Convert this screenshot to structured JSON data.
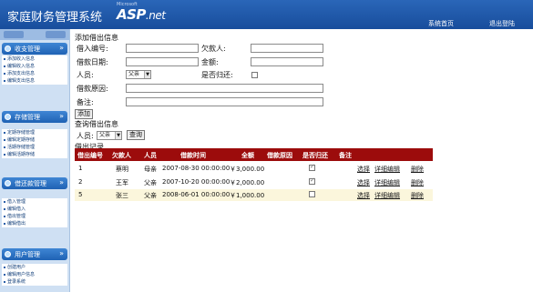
{
  "header": {
    "title": "家庭财务管理系统",
    "logo_small": "Microsoft",
    "logo_main": "ASP",
    "logo_net": ".net",
    "home_link": "系统首页",
    "logout_link": "退出登陆"
  },
  "sidebar": {
    "sections": [
      {
        "title": "收支管理",
        "items": [
          "添加收入信息",
          "编辑收入信息",
          "添加支出信息",
          "编辑支出信息"
        ]
      },
      {
        "title": "存储管理",
        "items": [
          "定期存储管理",
          "编辑定期存储",
          "活期存储管理",
          "编辑活期存储"
        ]
      },
      {
        "title": "借还款管理",
        "items": [
          "借入管理",
          "编辑借入",
          "借出管理",
          "编辑借出"
        ]
      },
      {
        "title": "用户管理",
        "items": [
          "创建用户",
          "编辑用户信息",
          "登录系统"
        ]
      }
    ]
  },
  "form": {
    "section_title": "添加借出信息",
    "borrow_no_label": "借入编号:",
    "debtor_label": "欠款人:",
    "date_label": "借款日期:",
    "amount_label": "金额:",
    "person_label": "人员:",
    "person_value": "父亲",
    "returned_label": "是否归还:",
    "reason_label": "借款原因:",
    "note_label": "备注:",
    "add_button": "添加"
  },
  "query": {
    "section_title": "查询借出信息",
    "person_label": "人员:",
    "person_value": "父亲",
    "query_button": "查询",
    "records_title": "借出记录"
  },
  "table": {
    "headers": [
      "借出编号",
      "欠款人",
      "人员",
      "借款时间",
      "全额",
      "借款原因",
      "是否归还",
      "备注"
    ],
    "rows": [
      {
        "id": "1",
        "debtor": "蔡明",
        "person": "母亲",
        "time": "2007-08-30 00:00:00",
        "amount": "￥3,000.00",
        "returned": true,
        "actions": [
          "选择",
          "详细编辑",
          "删除"
        ]
      },
      {
        "id": "2",
        "debtor": "王军",
        "person": "父亲",
        "time": "2007-10-20 00:00:00",
        "amount": "￥2,000.00",
        "returned": true,
        "actions": [
          "选择",
          "详细编辑",
          "删除"
        ]
      },
      {
        "id": "5",
        "debtor": "张三",
        "person": "父亲",
        "time": "2008-06-01 00:00:00",
        "amount": "￥1,000.00",
        "returned": false,
        "actions": [
          "选择",
          "详细编辑",
          "删除"
        ]
      }
    ]
  }
}
